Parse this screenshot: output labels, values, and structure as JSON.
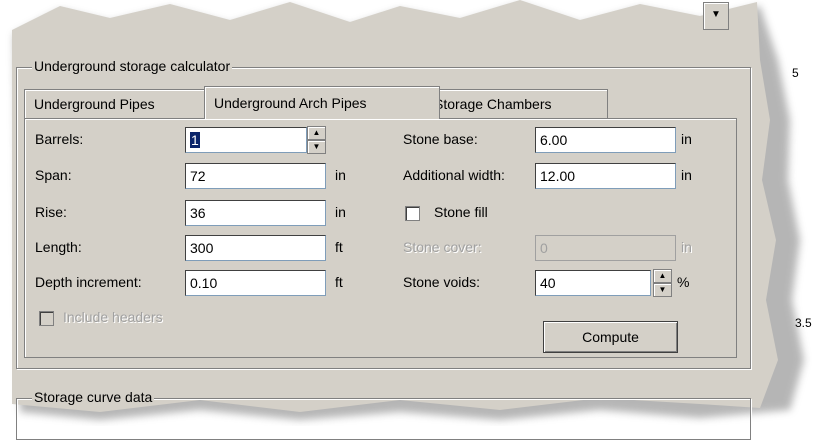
{
  "calculator": {
    "group_title": "Underground storage calculator",
    "tabs": [
      {
        "label": "Underground Pipes"
      },
      {
        "label": "Underground Arch Pipes"
      },
      {
        "label": "Storage Chambers"
      }
    ],
    "fields": {
      "barrels": {
        "label": "Barrels:",
        "value": "1"
      },
      "span": {
        "label": "Span:",
        "value": "72",
        "unit": "in"
      },
      "rise": {
        "label": "Rise:",
        "value": "36",
        "unit": "in"
      },
      "length": {
        "label": "Length:",
        "value": "300",
        "unit": "ft"
      },
      "depth_increment": {
        "label": "Depth increment:",
        "value": "0.10",
        "unit": "ft"
      },
      "stone_base": {
        "label": "Stone base:",
        "value": "6.00",
        "unit": "in"
      },
      "additional_width": {
        "label": "Additional width:",
        "value": "12.00",
        "unit": "in"
      },
      "stone_cover": {
        "label": "Stone cover:",
        "value": "0",
        "unit": "in"
      },
      "stone_voids": {
        "label": "Stone voids:",
        "value": "40",
        "unit": "%"
      }
    },
    "checkboxes": {
      "stone_fill": {
        "label": "Stone fill",
        "checked": false
      },
      "include_headers": {
        "label": "Include headers",
        "checked": false,
        "enabled": false
      }
    },
    "compute_label": "Compute"
  },
  "storage_curve": {
    "group_title": "Storage curve data"
  },
  "side_labels": {
    "top": "5",
    "middle": "3.5"
  },
  "icons": {
    "top_scroll": "chevron-down-icon",
    "spin_up": "arrow-up-icon",
    "spin_down": "arrow-down-icon"
  },
  "colors": {
    "dialog_bg": "#d4d0c8",
    "selection": "#0a246a"
  }
}
